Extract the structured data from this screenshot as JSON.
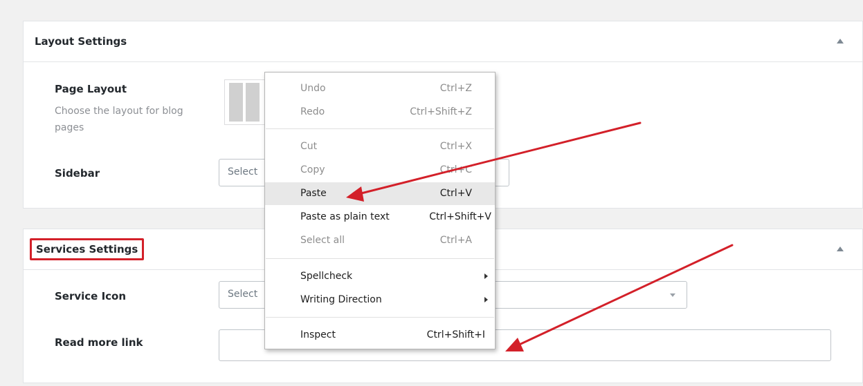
{
  "layout_settings": {
    "title": "Layout Settings",
    "page_layout_label": "Page Layout",
    "page_layout_desc": "Choose the layout for blog pages",
    "sidebar_label": "Sidebar",
    "sidebar_select_text": "Select"
  },
  "services_settings": {
    "title": "Services Settings",
    "service_icon_label": "Service Icon",
    "service_icon_select_text": "Select",
    "read_more_label": "Read more link",
    "read_more_value": ""
  },
  "context_menu": {
    "items": [
      {
        "label": "Undo",
        "shortcut": "Ctrl+Z"
      },
      {
        "label": "Redo",
        "shortcut": "Ctrl+Shift+Z"
      },
      {
        "label": "Cut",
        "shortcut": "Ctrl+X"
      },
      {
        "label": "Copy",
        "shortcut": "Ctrl+C"
      },
      {
        "label": "Paste",
        "shortcut": "Ctrl+V"
      },
      {
        "label": "Paste as plain text",
        "shortcut": "Ctrl+Shift+V"
      },
      {
        "label": "Select all",
        "shortcut": "Ctrl+A"
      },
      {
        "label": "Spellcheck",
        "shortcut": ""
      },
      {
        "label": "Writing Direction",
        "shortcut": ""
      },
      {
        "label": "Inspect",
        "shortcut": "Ctrl+Shift+I"
      }
    ]
  },
  "colors": {
    "annotation_red": "#d32029",
    "page_background": "#f1f1f1",
    "menu_hover": "#e8e8e8"
  },
  "icons": {
    "collapse": "triangle-up-icon",
    "dropdown": "chevron-down-icon",
    "submenu": "chevron-right-icon"
  }
}
